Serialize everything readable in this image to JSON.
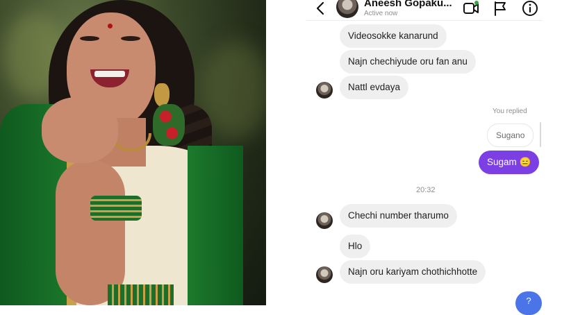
{
  "header": {
    "contact_name": "Aneesh Gopaku...",
    "status": "Active now"
  },
  "messages": [
    {
      "side": "in",
      "text": "Videosokke kanarund",
      "avatar": false
    },
    {
      "side": "in",
      "text": "Najn chechiyude oru fan anu",
      "avatar": false
    },
    {
      "side": "in",
      "text": "Nattl evdaya",
      "avatar": true
    },
    {
      "side": "out",
      "text": "Sugam 😑",
      "quoted": "Sugano",
      "reply_label": "You replied"
    },
    {
      "side": "in",
      "text": "Chechi number tharumo",
      "avatar": true
    },
    {
      "side": "in",
      "text": "Hlo",
      "avatar": false
    },
    {
      "side": "in",
      "text": "Najn oru kariyam chothichhotte",
      "avatar": true
    },
    {
      "side": "out",
      "text": "?"
    }
  ],
  "timestamp": "20:32",
  "colors": {
    "outgoing_bubble": "#7b3fe4",
    "incoming_bubble": "#efefef",
    "partial_bubble": "#4a74e8"
  },
  "icons": [
    "back-icon",
    "video-call-icon",
    "flag-icon",
    "info-icon"
  ]
}
